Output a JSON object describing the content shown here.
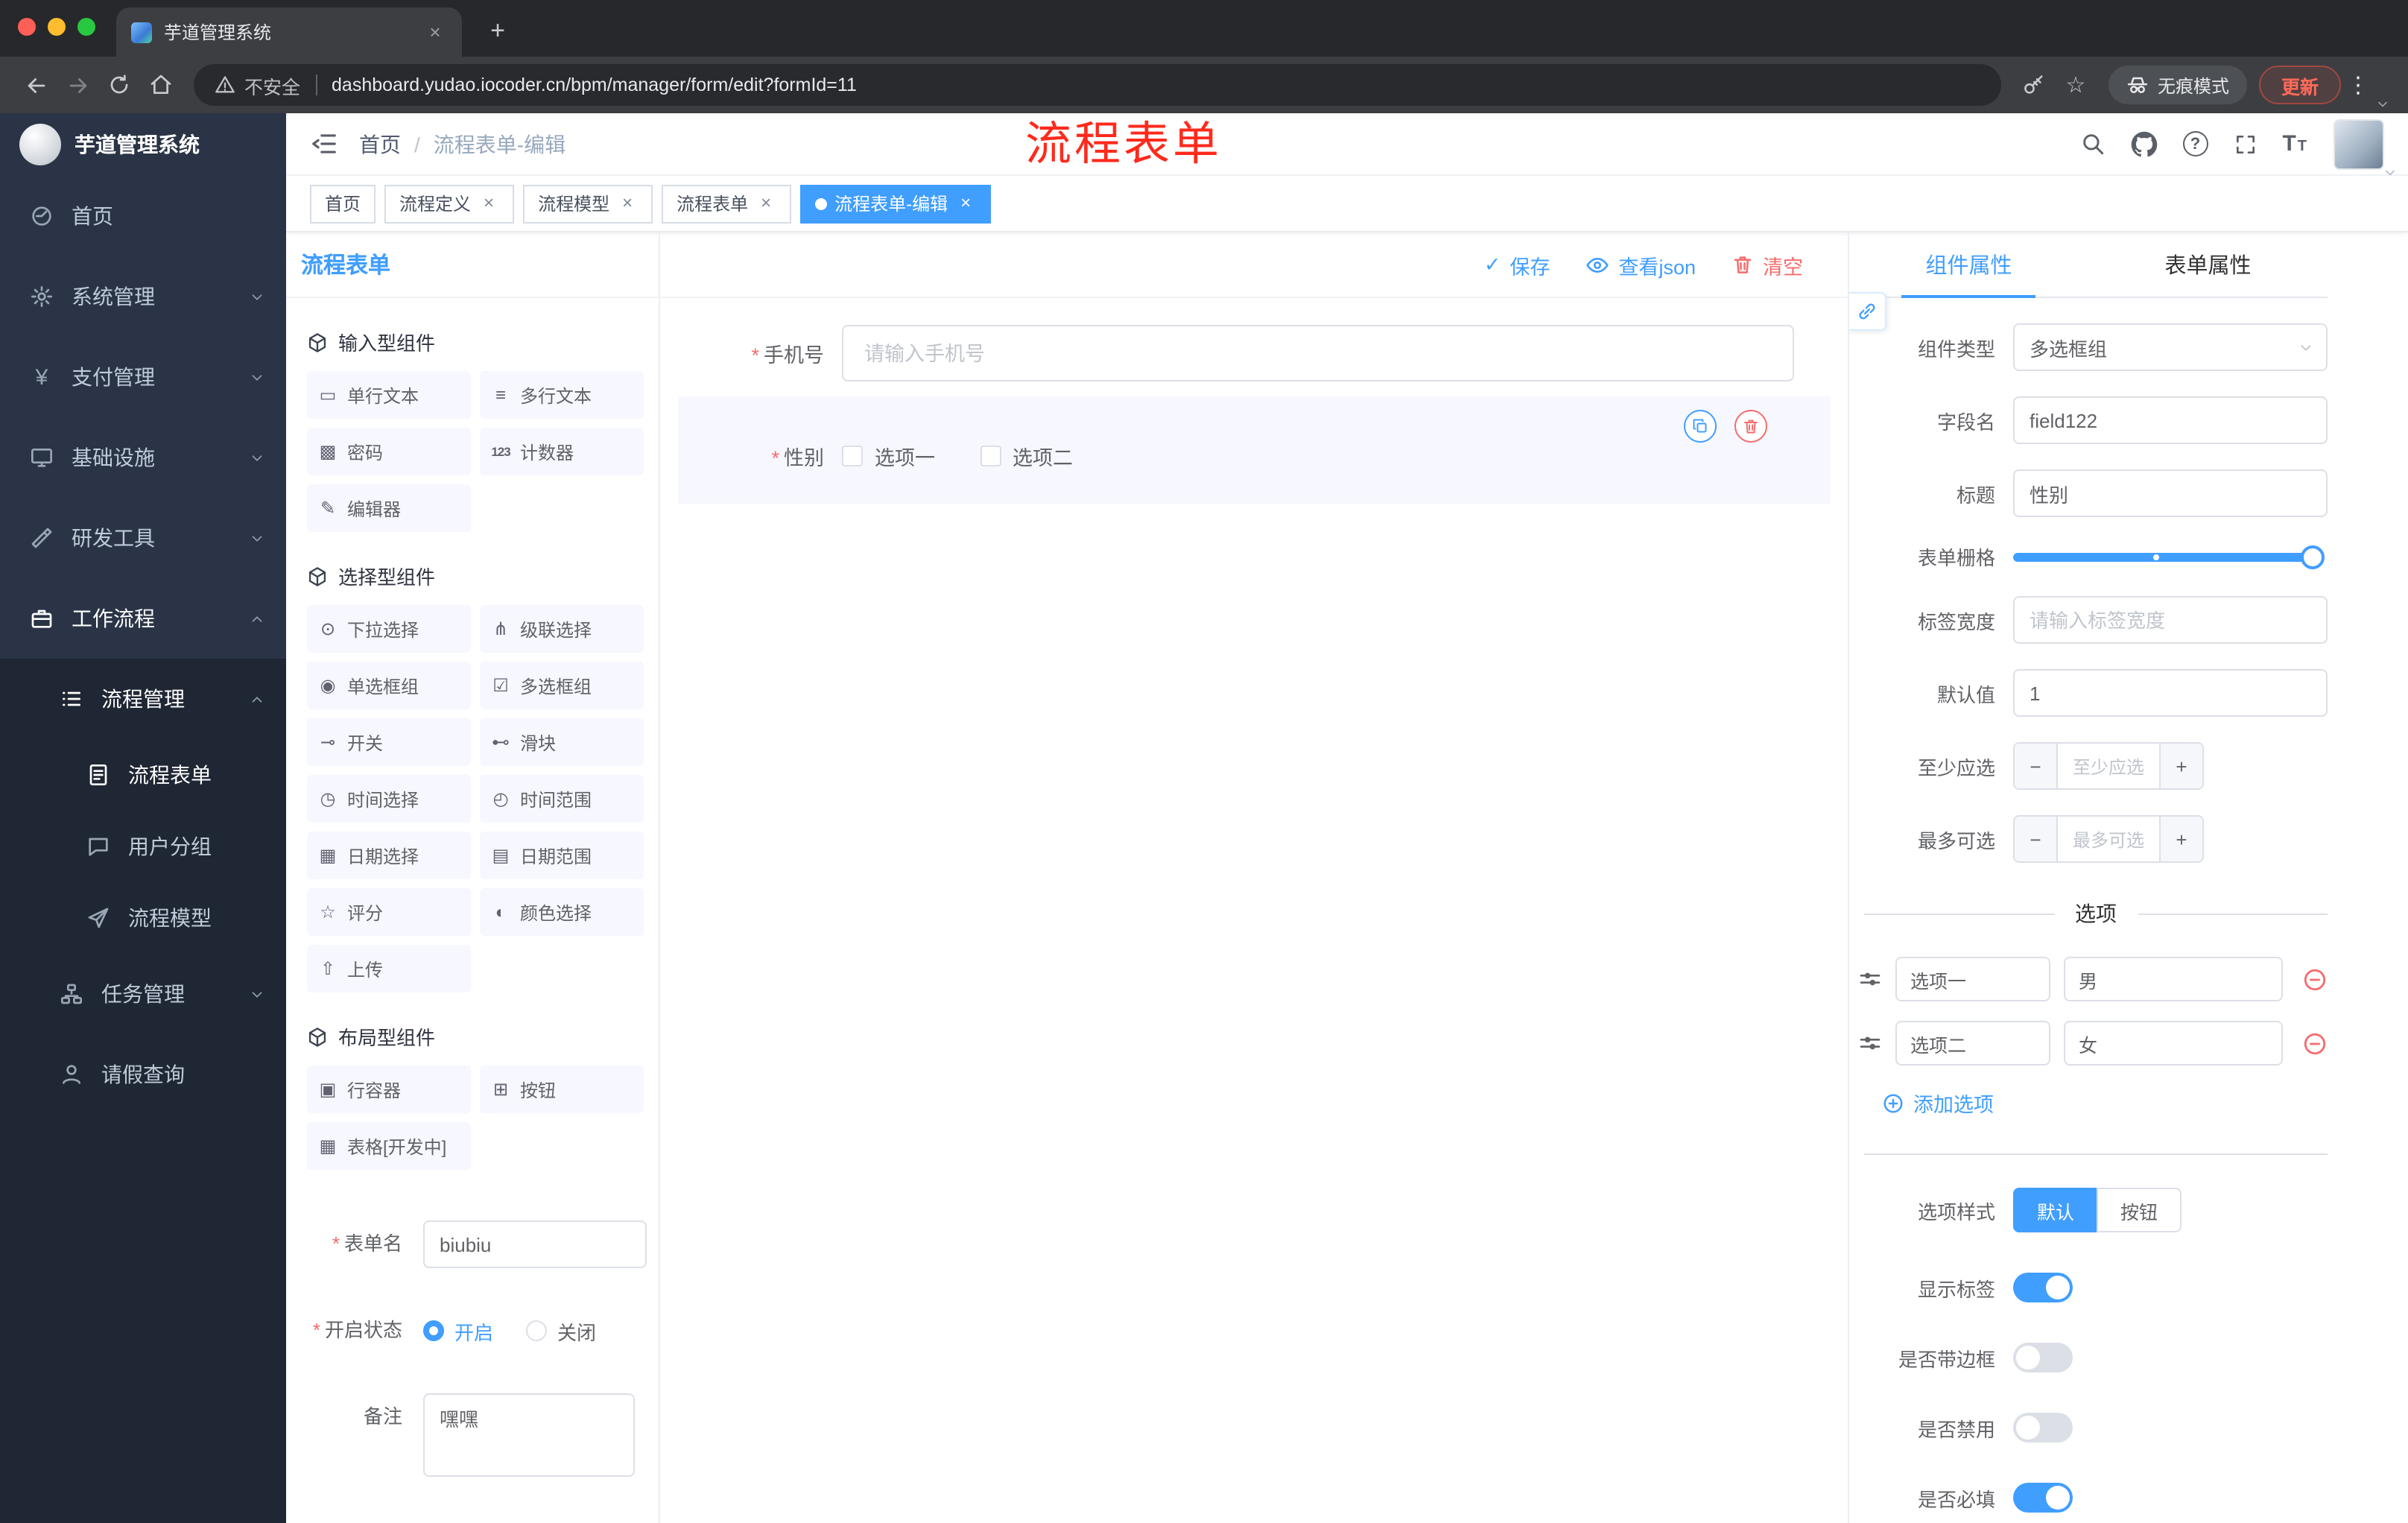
{
  "colors": {
    "primary": "#409eff",
    "danger": "#f56c6c",
    "annotation_red": "#ff2a1c",
    "sidebar_bg": "#2a3446",
    "traffic_red": "#ff5f57",
    "traffic_yellow": "#febc2e",
    "traffic_green": "#28c840"
  },
  "icons": {
    "single_text": "▭",
    "multi_text": "≡",
    "password": "▩",
    "counter": "123",
    "editor": "✎",
    "select": "⊙",
    "cascader": "⋔",
    "radio_group": "◉",
    "checkbox_group": "☑",
    "switch": "⊸",
    "slider": "⊷",
    "time": "◷",
    "time_range": "◴",
    "date": "▦",
    "date_range": "▤",
    "rate": "☆",
    "color": "◐",
    "upload": "⇧",
    "row_container": "▣",
    "button": "⊞",
    "table": "▦",
    "yen": "¥",
    "close": "×",
    "plus": "+",
    "kebab": "⋮",
    "minus": "−",
    "check": "✓",
    "star": "☆"
  },
  "browser": {
    "tab_title": "芋道管理系统",
    "security_label": "不安全",
    "url": "dashboard.yudao.iocoder.cn/bpm/manager/form/edit?formId=11",
    "incognito_label": "无痕模式",
    "update_label": "更新"
  },
  "sidebar": {
    "app_title": "芋道管理系统",
    "items": [
      {
        "label": "首页"
      },
      {
        "label": "系统管理"
      },
      {
        "label": "支付管理"
      },
      {
        "label": "基础设施"
      },
      {
        "label": "研发工具"
      },
      {
        "label": "工作流程"
      },
      {
        "label": "流程管理"
      },
      {
        "label": "流程表单"
      },
      {
        "label": "用户分组"
      },
      {
        "label": "流程模型"
      },
      {
        "label": "任务管理"
      },
      {
        "label": "请假查询"
      }
    ]
  },
  "header": {
    "breadcrumb_home": "首页",
    "breadcrumb_sep": "/",
    "breadcrumb_current": "流程表单-编辑",
    "annotation": "流程表单"
  },
  "tags": {
    "items": [
      {
        "label": "首页"
      },
      {
        "label": "流程定义"
      },
      {
        "label": "流程模型"
      },
      {
        "label": "流程表单"
      },
      {
        "label": "流程表单-编辑"
      }
    ]
  },
  "designer": {
    "panel_title": "流程表单",
    "save": "保存",
    "view_json": "查看json",
    "clear": "清空",
    "groups": [
      {
        "title": "输入型组件",
        "items": [
          "单行文本",
          "多行文本",
          "密码",
          "计数器",
          "编辑器"
        ]
      },
      {
        "title": "选择型组件",
        "items": [
          "下拉选择",
          "级联选择",
          "单选框组",
          "多选框组",
          "开关",
          "滑块",
          "时间选择",
          "时间范围",
          "日期选择",
          "日期范围",
          "评分",
          "颜色选择",
          "上传"
        ]
      },
      {
        "title": "布局型组件",
        "items": [
          "行容器",
          "按钮",
          "表格[开发中]"
        ]
      }
    ],
    "form_meta": {
      "name_label": "表单名",
      "name_value": "biubiu",
      "status_label": "开启状态",
      "status_on": "开启",
      "status_off": "关闭",
      "remark_label": "备注",
      "remark_value": "嘿嘿"
    }
  },
  "canvas": {
    "phone_label": "手机号",
    "phone_placeholder": "请输入手机号",
    "gender_label": "性别",
    "gender_opt1": "选项一",
    "gender_opt2": "选项二"
  },
  "props": {
    "tab_component": "组件属性",
    "tab_form": "表单属性",
    "component_type_label": "组件类型",
    "component_type_value": "多选框组",
    "field_name_label": "字段名",
    "field_name_value": "field122",
    "title_label": "标题",
    "title_value": "性别",
    "grid_label": "表单栅格",
    "label_width_label": "标签宽度",
    "label_width_placeholder": "请输入标签宽度",
    "default_label": "默认值",
    "default_value": "1",
    "min_label": "至少应选",
    "min_placeholder": "至少应选",
    "max_label": "最多可选",
    "max_placeholder": "最多可选",
    "options_title": "选项",
    "options": [
      {
        "label": "选项一",
        "value": "男"
      },
      {
        "label": "选项二",
        "value": "女"
      }
    ],
    "add_option": "添加选项",
    "option_style_label": "选项样式",
    "style_default": "默认",
    "style_button": "按钮",
    "show_label": "显示标签",
    "bordered_label": "是否带边框",
    "disabled_label": "是否禁用",
    "required_label": "是否必填"
  }
}
